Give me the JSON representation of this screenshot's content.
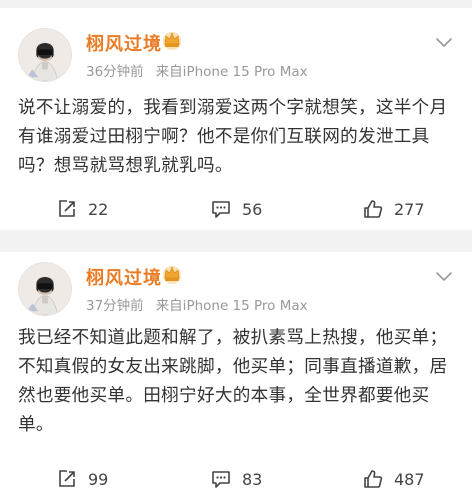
{
  "posts": [
    {
      "author": "栩风过境",
      "time": "36分钟前",
      "source": "来自iPhone 15 Pro Max",
      "text": "说不让溺爱的，我看到溺爱这两个字就想笑，这半个月有谁溺爱过田栩宁啊？他不是你们互联网的发泄工具吗？想骂就骂想乳就乳吗。",
      "reposts": "22",
      "comments": "56",
      "likes": "277"
    },
    {
      "author": "栩风过境",
      "time": "37分钟前",
      "source": "来自iPhone 15 Pro Max",
      "text": "我已经不知道此题和解了，被扒素骂上热搜，他买单；不知真假的女友出来跳脚，他买单；同事直播道歉，居然也要他买单。田栩宁好大的本事，全世界都要他买单。",
      "reposts": "99",
      "comments": "83",
      "likes": "487"
    }
  ],
  "icons": {
    "repost": "repost-icon",
    "comment": "comment-icon",
    "like": "like-icon",
    "more": "chevron-down-icon",
    "badge": "crown-badge-icon"
  },
  "colors": {
    "author": "#ea7c25",
    "meta": "#999999",
    "text": "#333333",
    "background": "#f2f2f2"
  }
}
